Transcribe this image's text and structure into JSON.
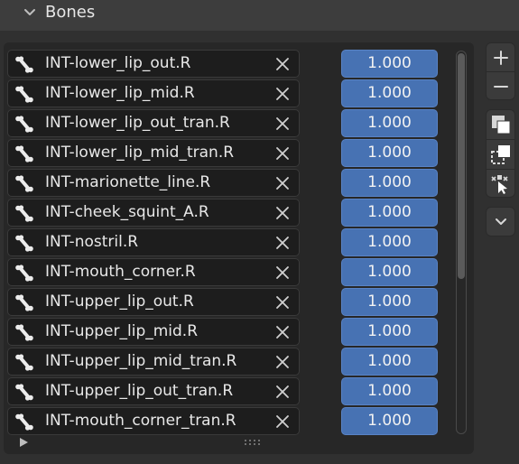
{
  "header": {
    "title": "Bones",
    "chevron_icon": "chevron-down-icon"
  },
  "bones": [
    {
      "name": "INT-lower_lip_out.R",
      "value": "1.000"
    },
    {
      "name": "INT-lower_lip_mid.R",
      "value": "1.000"
    },
    {
      "name": "INT-lower_lip_out_tran.R",
      "value": "1.000"
    },
    {
      "name": "INT-lower_lip_mid_tran.R",
      "value": "1.000"
    },
    {
      "name": "INT-marionette_line.R",
      "value": "1.000"
    },
    {
      "name": "INT-cheek_squint_A.R",
      "value": "1.000"
    },
    {
      "name": "INT-nostril.R",
      "value": "1.000"
    },
    {
      "name": "INT-mouth_corner.R",
      "value": "1.000"
    },
    {
      "name": "INT-upper_lip_out.R",
      "value": "1.000"
    },
    {
      "name": "INT-upper_lip_mid.R",
      "value": "1.000"
    },
    {
      "name": "INT-upper_lip_mid_tran.R",
      "value": "1.000"
    },
    {
      "name": "INT-upper_lip_out_tran.R",
      "value": "1.000"
    },
    {
      "name": "INT-mouth_corner_tran.R",
      "value": "1.000"
    }
  ],
  "side_tools": [
    "plus-icon",
    "minus-icon",
    "select-all-icon",
    "deselect-icon",
    "select-pick-icon",
    "chevron-down-icon"
  ],
  "colors": {
    "value_field": "#4772b3",
    "name_field": "#1d1d1d",
    "panel": "#303030"
  }
}
